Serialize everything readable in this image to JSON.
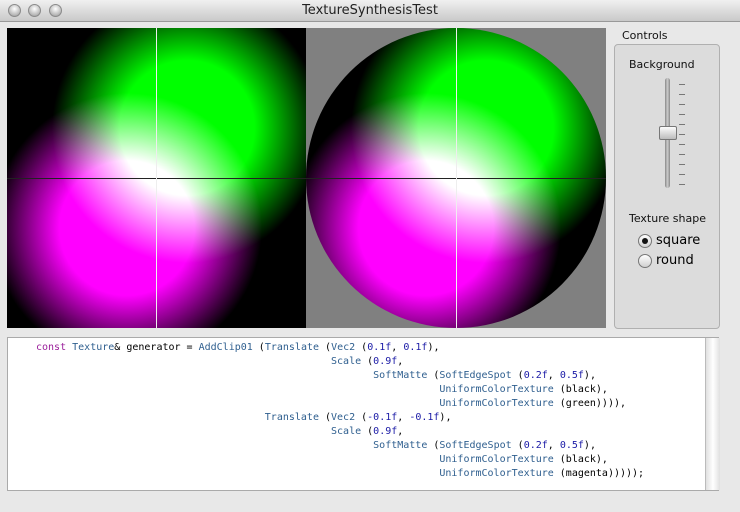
{
  "window": {
    "title": "TextureSynthesisTest"
  },
  "controls": {
    "group_label": "Controls",
    "background_label": "Background",
    "background_level": 0.5,
    "texture_shape_label": "Texture shape",
    "shape_options": [
      {
        "label": "square",
        "selected": true
      },
      {
        "label": "round",
        "selected": false
      }
    ]
  },
  "preview": {
    "background_color": "#808080",
    "spot_colors": [
      "#00ff00",
      "#ff00ff"
    ]
  },
  "code_lines": [
    "const Texture& generator = AddClip01 (Translate (Vec2 (0.1f, 0.1f),",
    "                                                 Scale (0.9f,",
    "                                                        SoftMatte (SoftEdgeSpot (0.2f, 0.5f),",
    "                                                                   UniformColorTexture (black),",
    "                                                                   UniformColorTexture (green)))),",
    "                                      Translate (Vec2 (-0.1f, -0.1f),",
    "                                                 Scale (0.9f,",
    "                                                        SoftMatte (SoftEdgeSpot (0.2f, 0.5f),",
    "                                                                   UniformColorTexture (black),",
    "                                                                   UniformColorTexture (magenta)))));"
  ]
}
